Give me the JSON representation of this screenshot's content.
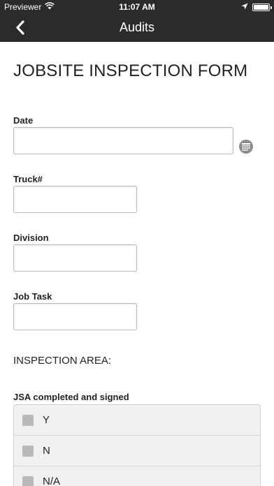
{
  "status_bar": {
    "carrier": "Previewer",
    "time": "11:07 AM",
    "battery_level": 1.0
  },
  "nav": {
    "title": "Audits",
    "back_icon": "chevron-left-icon"
  },
  "form": {
    "title": "JOBSITE INSPECTION FORM",
    "fields": [
      {
        "label": "Date",
        "value": "",
        "icon": "calendar-icon"
      },
      {
        "label": "Truck#",
        "value": ""
      },
      {
        "label": "Division",
        "value": ""
      },
      {
        "label": "Job Task",
        "value": ""
      }
    ],
    "section_title": "INSPECTION AREA:",
    "question": {
      "label": "JSA completed and signed",
      "options": [
        "Y",
        "N",
        "N/A"
      ]
    }
  }
}
